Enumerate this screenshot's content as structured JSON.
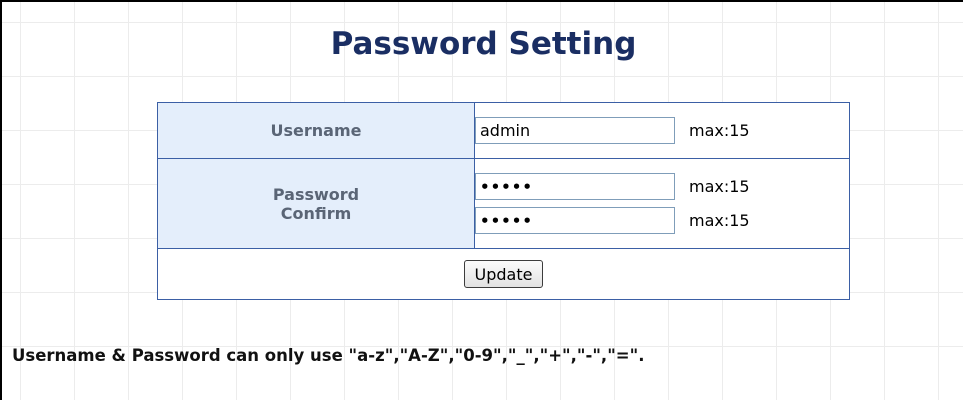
{
  "page": {
    "title": "Password Setting"
  },
  "form": {
    "username_label": "Username",
    "username_value": "admin",
    "username_max": "max:15",
    "password_label": "Password",
    "confirm_label": "Confirm",
    "password_value": "admin",
    "password_max": "max:15",
    "confirm_value": "admin",
    "confirm_max": "max:15",
    "update_label": "Update"
  },
  "note": {
    "text": "Username & Password can only use \"a-z\",\"A-Z\",\"0-9\",\"_\",\"+\",\"-\",\"=\"."
  },
  "colors": {
    "title": "#1a2e63",
    "label_background": "#e4eefb",
    "label_text": "#5a6576",
    "table_border": "#3b5fa5"
  }
}
